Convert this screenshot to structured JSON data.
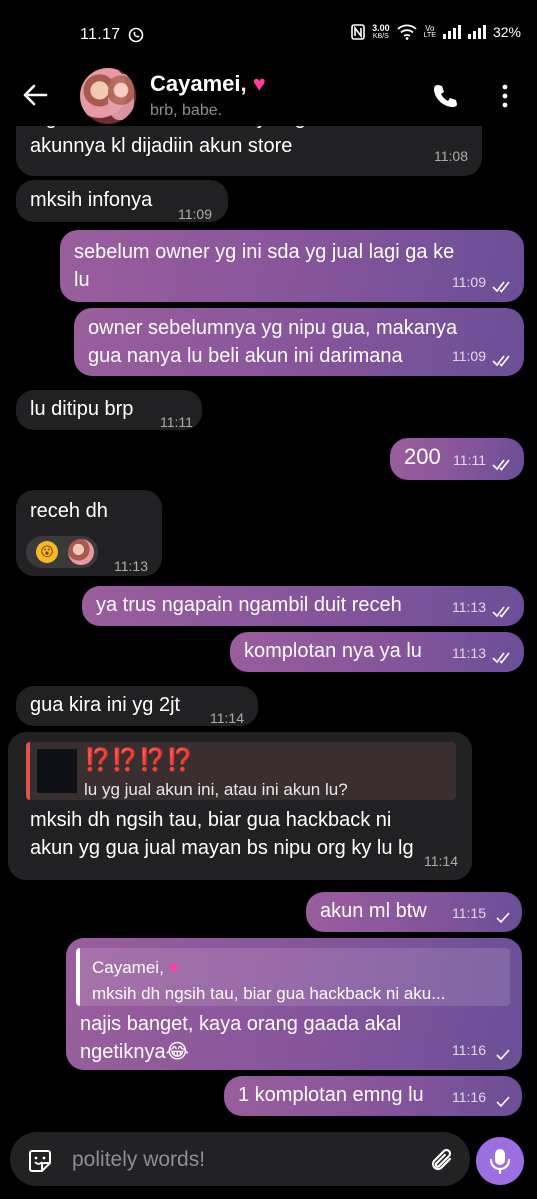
{
  "status_bar": {
    "time": "11.17",
    "net_speed": "3.00",
    "net_unit": "KB/S",
    "volte": "Vo",
    "lte": "LTE",
    "battery": "32%"
  },
  "header": {
    "contact_name": "Cayamei, ",
    "status": "brb, babe."
  },
  "messages": [
    {
      "id": "m0",
      "dir": "in",
      "text": "big sm owner akun ini mayan gua takeback\nakunnya kl dijadiin akun store",
      "time": "11:08"
    },
    {
      "id": "m1",
      "dir": "in",
      "text": "mksih infonya",
      "time": "11:09"
    },
    {
      "id": "m2",
      "dir": "out",
      "text": "sebelum owner yg ini sda yg jual lagi ga ke\nlu",
      "time": "11:09",
      "status": "read"
    },
    {
      "id": "m3",
      "dir": "out",
      "text": "owner sebelumnya yg nipu gua, makanya\ngua nanya lu beli akun ini darimana",
      "time": "11:09",
      "status": "read"
    },
    {
      "id": "m4",
      "dir": "in",
      "text": "lu ditipu brp",
      "time": "11:11"
    },
    {
      "id": "m5",
      "dir": "out",
      "text": "200",
      "time": "11:11",
      "status": "read"
    },
    {
      "id": "m6",
      "dir": "in",
      "text": "receh dh",
      "time": "11:13",
      "reactions": [
        "yawning-face-emoji",
        "contact-avatar"
      ]
    },
    {
      "id": "m7",
      "dir": "out",
      "text": "ya trus ngapain ngambil duit receh",
      "time": "11:13",
      "status": "read"
    },
    {
      "id": "m8",
      "dir": "out",
      "text": "komplotan nya ya lu",
      "time": "11:13",
      "status": "read"
    },
    {
      "id": "m9",
      "dir": "in",
      "text": "gua kira ini yg 2jt",
      "time": "11:14"
    },
    {
      "id": "m10",
      "dir": "in",
      "quote": {
        "title": "⁉️⁉️⁉️⁉️",
        "text": "lu yg jual akun ini, atau ini akun lu?"
      },
      "text": "mksih dh ngsih tau, biar gua hackback ni\nakun yg gua jual mayan bs nipu org ky lu lg",
      "time": "11:14"
    },
    {
      "id": "m11",
      "dir": "out",
      "text": "akun ml btw",
      "time": "11:15",
      "status": "delivered"
    },
    {
      "id": "m12",
      "dir": "out",
      "quote": {
        "name": "Cayamei, ",
        "text": "mksih dh ngsih tau, biar gua hackback ni aku..."
      },
      "text": "najis banget, kaya orang gaada akal\nngetiknya😂",
      "time": "11:16",
      "status": "delivered"
    },
    {
      "id": "m13",
      "dir": "out",
      "text": "1 komplotan emng lu",
      "time": "11:16",
      "status": "delivered"
    }
  ],
  "composer": {
    "placeholder": "politely words!"
  },
  "colors": {
    "background": "#000000",
    "incoming_bubble": "#212123",
    "outgoing_bubble_start": "#9a5e9d",
    "outgoing_bubble_end": "#6a4f98",
    "mic_button": "#9b6fe0",
    "quote_accent": "#e0544a"
  }
}
